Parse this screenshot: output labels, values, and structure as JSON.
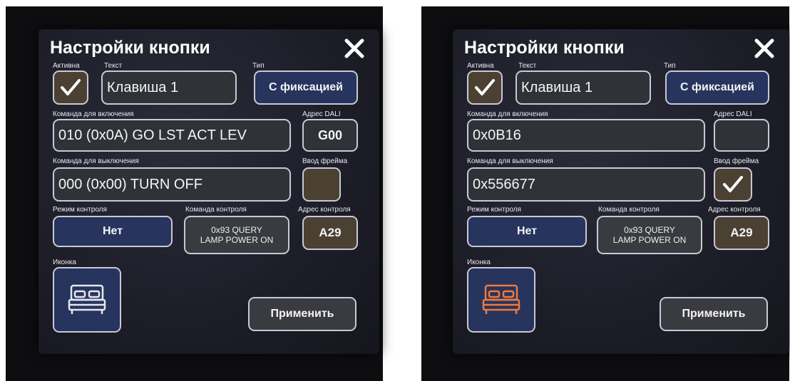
{
  "panels": [
    {
      "title": "Настройки кнопки",
      "labels": {
        "active": "Активна",
        "text": "Текст",
        "type": "Тип",
        "cmd_on": "Команда для включения",
        "dali": "Адрес DALI",
        "cmd_off": "Команда для выключения",
        "frame": "Ввод фрейма",
        "mode": "Режим контроля",
        "ctrl_cmd": "Команда контроля",
        "ctrl_addr": "Адрес контроля",
        "icon": "Иконка"
      },
      "text_value": "Клавиша 1",
      "type_value": "С фиксацией",
      "cmd_on_value": "010 (0x0A) GO LST ACT LEV",
      "dali_value": "G00",
      "cmd_off_value": "000 (0x00) TURN OFF",
      "frame_value": "",
      "mode_value": "Нет",
      "ctrl_cmd_line1": "0x93 QUERY",
      "ctrl_cmd_line2": "LAMP POWER ON",
      "ctrl_addr_value": "A29",
      "apply": "Применить",
      "active_checked": true,
      "frame_checked": false,
      "icon_name": "bed-icon",
      "icon_color": "#e6e6ee"
    },
    {
      "title": "Настройки кнопки",
      "labels": {
        "active": "Активна",
        "text": "Текст",
        "type": "Тип",
        "cmd_on": "Команда для включения",
        "dali": "Адрес DALI",
        "cmd_off": "Команда для выключения",
        "frame": "Ввод фрейма",
        "mode": "Режим контроля",
        "ctrl_cmd": "Команда контроля",
        "ctrl_addr": "Адрес контроля",
        "icon": "Иконка"
      },
      "text_value": "Клавиша 1",
      "type_value": "С фиксацией",
      "cmd_on_value": "0x0B16",
      "dali_value": "",
      "cmd_off_value": "0x556677",
      "frame_value": "",
      "mode_value": "Нет",
      "ctrl_cmd_line1": "0x93 QUERY",
      "ctrl_cmd_line2": "LAMP POWER ON",
      "ctrl_addr_value": "A29",
      "apply": "Применить",
      "active_checked": true,
      "frame_checked": true,
      "icon_name": "bed-icon",
      "icon_color": "#f07a3a"
    }
  ]
}
